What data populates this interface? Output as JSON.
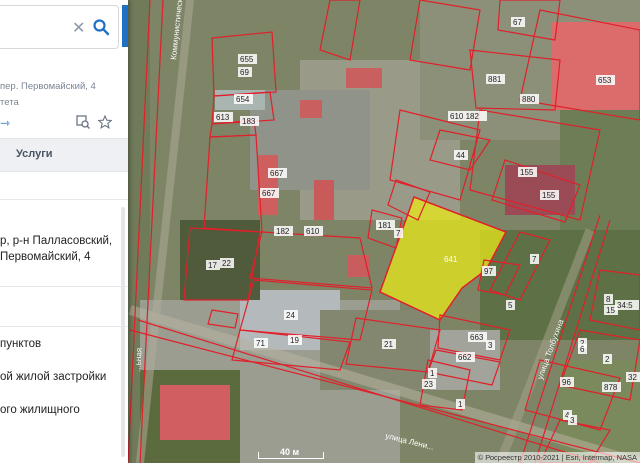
{
  "search": {
    "clear_icon": "close-icon",
    "search_icon": "search-icon",
    "accent": "#1f6fc5"
  },
  "panel": {
    "address": "пер. Первомайский, 4",
    "subtitle": "тета",
    "tab_label": "Услуги",
    "detail_line1": "р, р-н Палласовский,",
    "detail_line2": "Первомайский, 4",
    "items": [
      "пунктов",
      "ой жилой застройки",
      "ого жилищного"
    ]
  },
  "map": {
    "streets": [
      {
        "id": "kommunisticheskaya",
        "label": "Коммунистическая"
      },
      {
        "id": "left-street",
        "label": "...ьная"
      },
      {
        "id": "lenina",
        "label": "улица Лени..."
      },
      {
        "id": "tolbukhina",
        "label": "улица Толбухина"
      }
    ],
    "parcel_numbers": [
      "655",
      "69",
      "654",
      "613",
      "183",
      "667",
      "667",
      "182",
      "610",
      "181",
      "7",
      "641",
      "97",
      "7",
      "5",
      "17",
      "22",
      "24",
      "71",
      "19",
      "21",
      "663",
      "3",
      "662",
      "2",
      "23",
      "1",
      "1",
      "610 182",
      "44",
      "155",
      "155",
      "881",
      "880",
      "653",
      "67",
      "8",
      "15",
      "34:5",
      "6",
      "2",
      "96",
      "878",
      "32",
      "4",
      "3"
    ],
    "highlighted_parcel": "641",
    "highlight_color": "#e8e81a",
    "boundary_color": "#e0202a",
    "scale_label": "40 м",
    "attribution": "© Росреестр 2010-2021 | Esri, Intermap, NASA"
  }
}
